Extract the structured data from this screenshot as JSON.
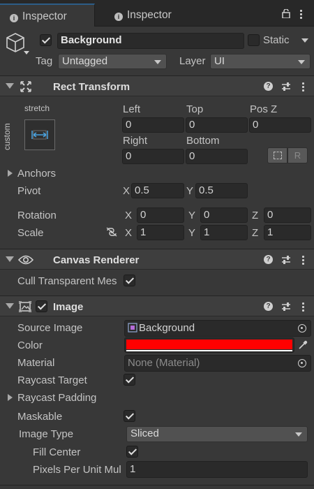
{
  "tabs": [
    {
      "label": "Inspector",
      "active": true
    },
    {
      "label": "Inspector",
      "active": false
    }
  ],
  "object": {
    "active": true,
    "name": "Background",
    "static_label": "Static",
    "static": false,
    "tag_label": "Tag",
    "tag_value": "Untagged",
    "layer_label": "Layer",
    "layer_value": "UI"
  },
  "rect_transform": {
    "title": "Rect Transform",
    "anchor_preset_top": "stretch",
    "anchor_preset_side": "custom",
    "left_label": "Left",
    "left": "0",
    "top_label": "Top",
    "top": "0",
    "posz_label": "Pos Z",
    "posz": "0",
    "right_label": "Right",
    "right": "0",
    "bottom_label": "Bottom",
    "bottom": "0",
    "raw_label": "R",
    "anchors_label": "Anchors",
    "pivot_label": "Pivot",
    "pivot_x": "0.5",
    "pivot_y": "0.5",
    "rotation_label": "Rotation",
    "rot_x": "0",
    "rot_y": "0",
    "rot_z": "0",
    "scale_label": "Scale",
    "scale_x": "1",
    "scale_y": "1",
    "scale_z": "1",
    "x": "X",
    "y": "Y",
    "z": "Z"
  },
  "canvas_renderer": {
    "title": "Canvas Renderer",
    "cull_label": "Cull Transparent Mes",
    "cull": true
  },
  "image": {
    "title": "Image",
    "enabled": true,
    "source_label": "Source Image",
    "source_value": "Background",
    "color_label": "Color",
    "color": "#ff0000",
    "material_label": "Material",
    "material_value": "None (Material)",
    "raycast_target_label": "Raycast Target",
    "raycast_target": true,
    "raycast_padding_label": "Raycast Padding",
    "maskable_label": "Maskable",
    "maskable": true,
    "image_type_label": "Image Type",
    "image_type_value": "Sliced",
    "fill_center_label": "Fill Center",
    "fill_center": true,
    "ppu_label": "Pixels Per Unit Mul",
    "ppu_value": "1"
  },
  "colors": {
    "accent": "#2c5d87",
    "panel": "#383838",
    "header": "#3e3e3e",
    "field": "#2a2a2a"
  }
}
